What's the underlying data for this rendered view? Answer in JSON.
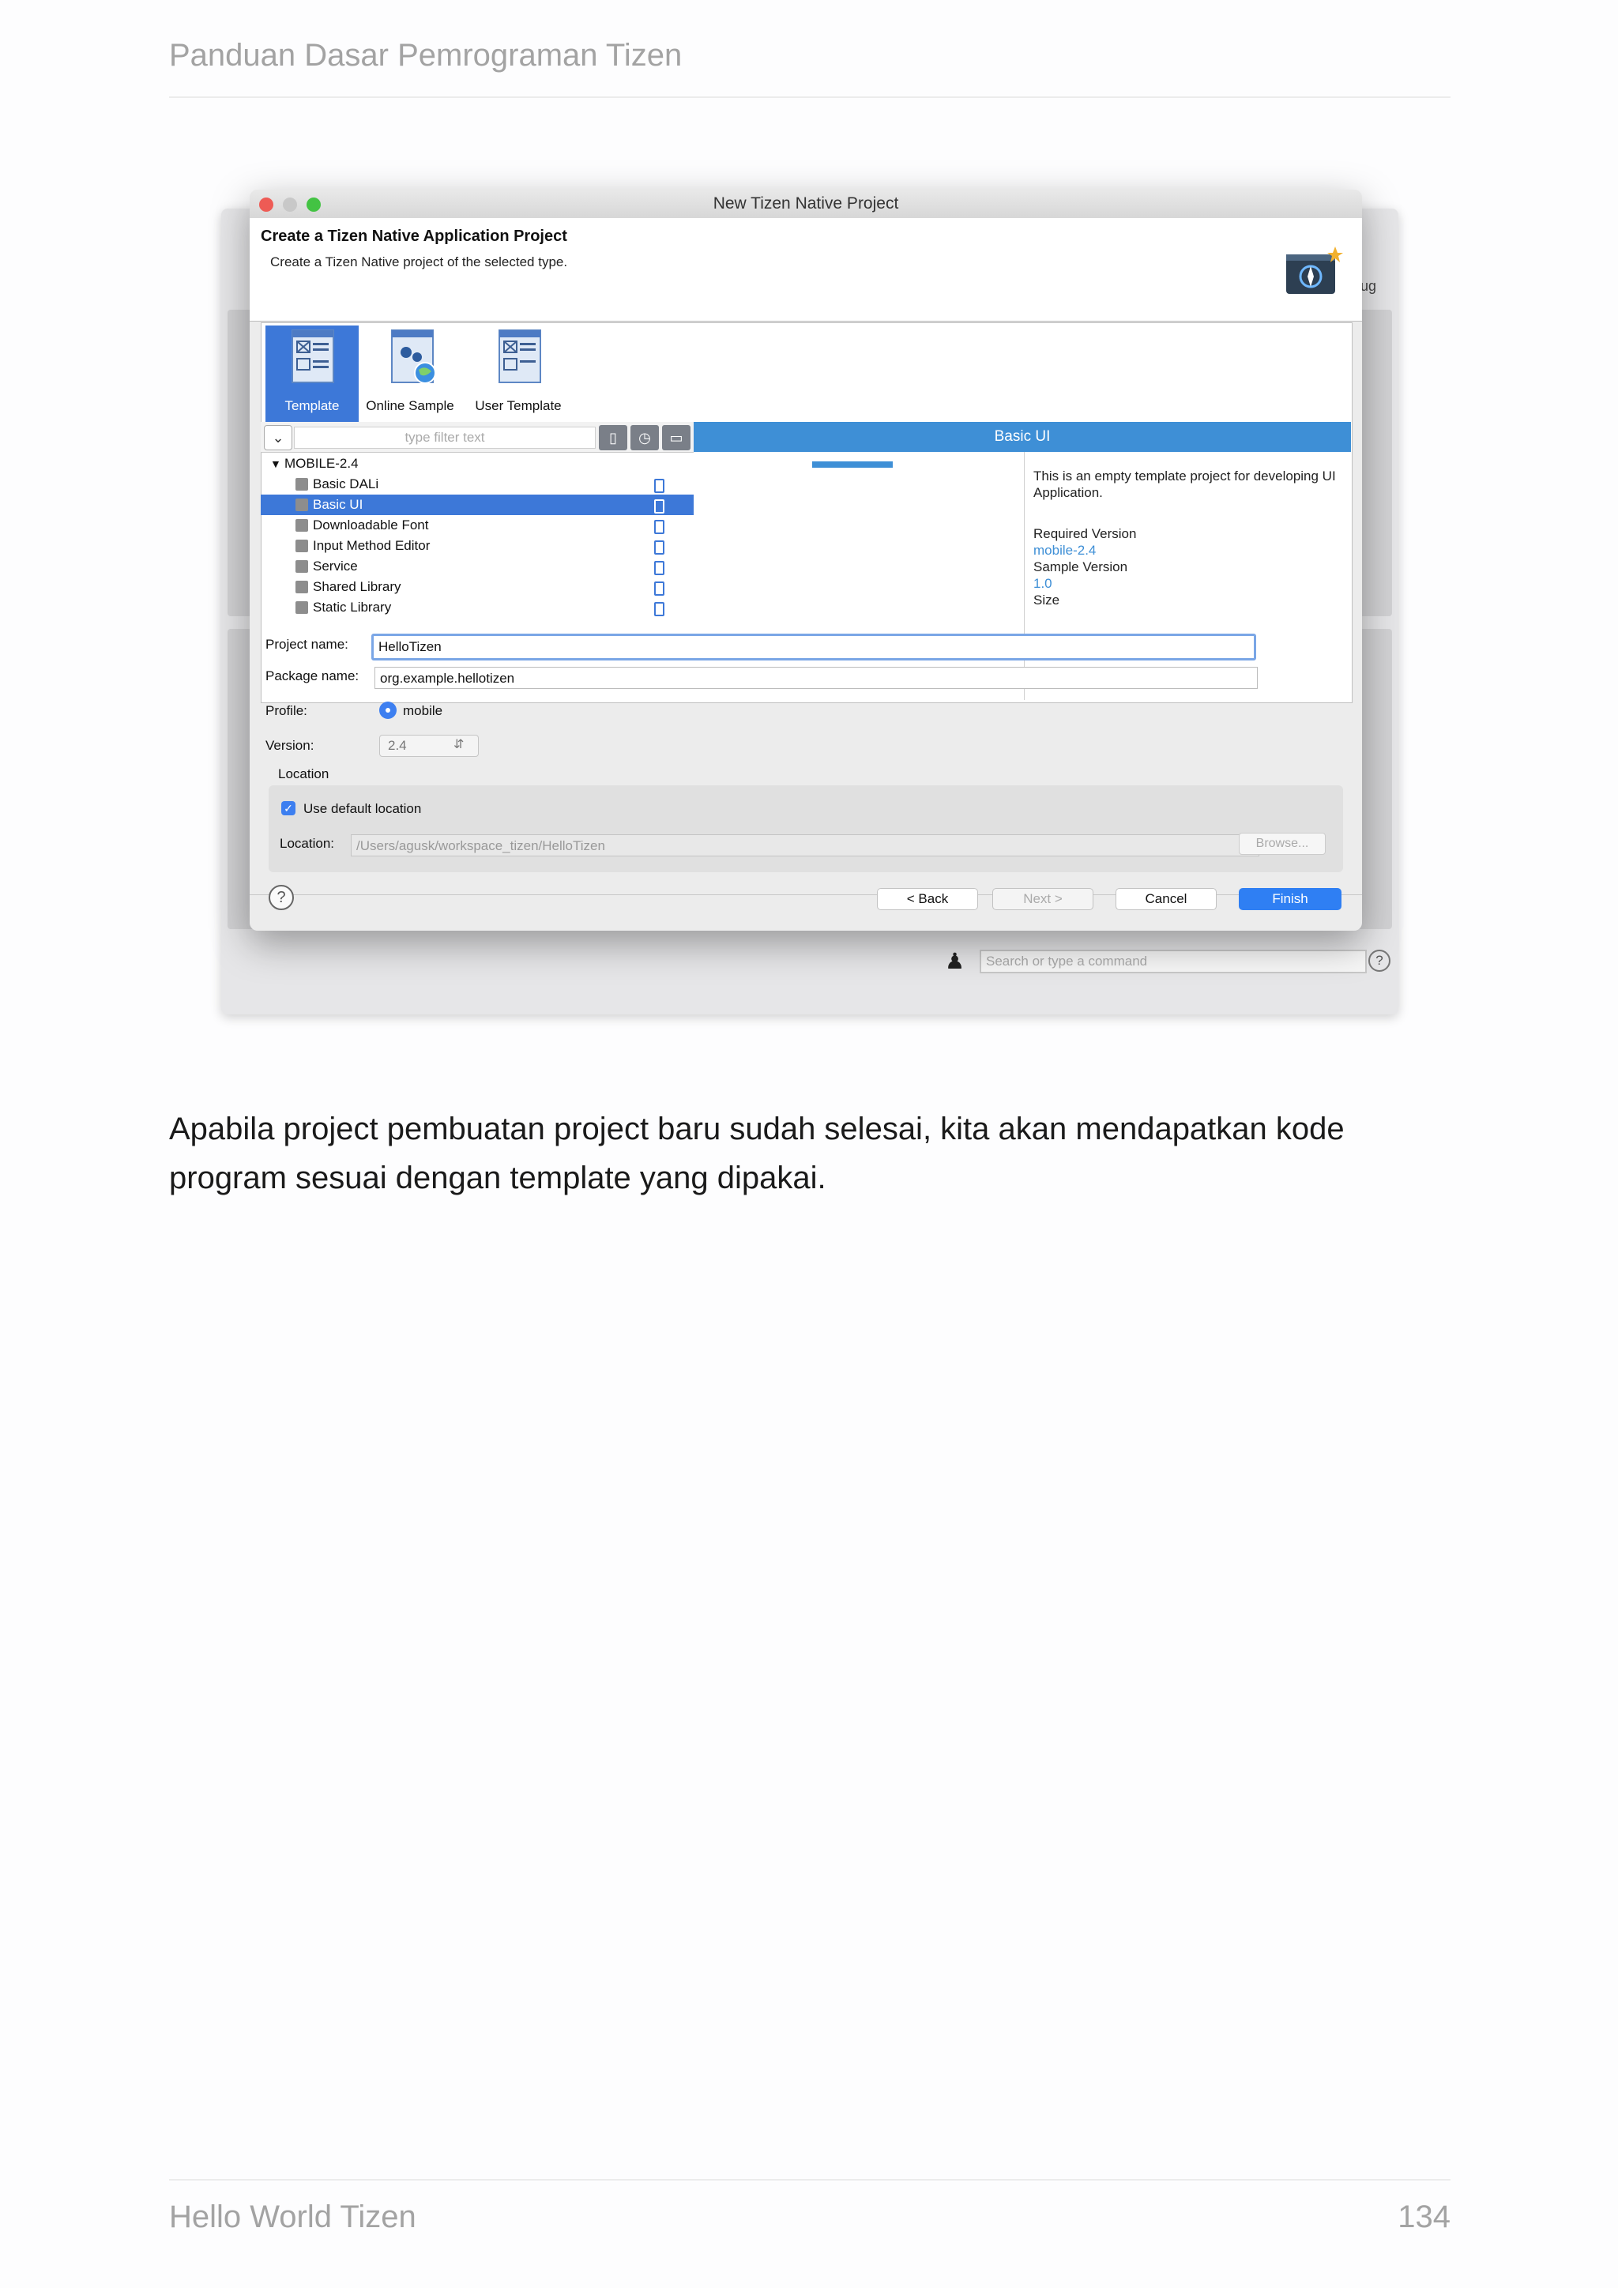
{
  "page": {
    "header": "Panduan Dasar Pemrograman Tizen",
    "footer_left": "Hello World Tizen",
    "footer_right": "134",
    "paragraph": "Apabila project pembuatan project baru sudah selesai, kita akan mendapatkan kode program sesuai dengan template yang dipakai."
  },
  "ide": {
    "side_text": "ug",
    "command_placeholder": "Search or type a command",
    "help": "?"
  },
  "dialog": {
    "title": "New Tizen Native Project",
    "banner_title": "Create a Tizen Native Application Project",
    "banner_subtitle": "Create a Tizen Native project of the selected type.",
    "tabs": [
      "Template",
      "Online Sample",
      "User Template"
    ],
    "filter_placeholder": "type filter text",
    "tree": {
      "root": "MOBILE-2.4",
      "items": [
        "Basic DALi",
        "Basic UI",
        "Downloadable Font",
        "Input Method Editor",
        "Service",
        "Shared Library",
        "Static Library"
      ],
      "selected": "Basic UI"
    },
    "preview": {
      "title": "Basic UI",
      "description": "This is an empty template project for developing UI Application.",
      "required_label": "Required Version",
      "required_value": "mobile-2.4",
      "sample_label": "Sample Version",
      "sample_value": "1.0",
      "size_label": "Size"
    },
    "form": {
      "project_name_label": "Project name:",
      "project_name": "HelloTizen",
      "package_name_label": "Package name:",
      "package_name": "org.example.hellotizen",
      "profile_label": "Profile:",
      "profile_value": "mobile",
      "version_label": "Version:",
      "version_value": "2.4",
      "location_group_label": "Location",
      "use_default_label": "Use default location",
      "location_label": "Location:",
      "location_value": "/Users/agusk/workspace_tizen/HelloTizen",
      "browse_label": "Browse..."
    },
    "buttons": {
      "help": "?",
      "back": "< Back",
      "next": "Next >",
      "cancel": "Cancel",
      "finish": "Finish"
    }
  }
}
